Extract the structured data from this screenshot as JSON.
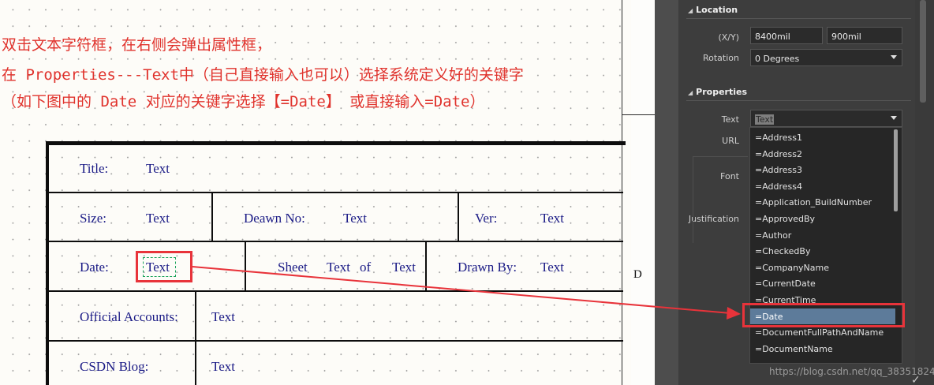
{
  "annotation": {
    "line1": "双击文本字符框，在右侧会弹出属性框，",
    "line2": "在 Properties---Text中（自己直接输入也可以）选择系统定义好的关键字",
    "line3": "（如下图中的 Date 对应的关键字选择【=Date】 或直接输入=Date）"
  },
  "title_block": {
    "title_label": "Title:",
    "title_value": "Text",
    "size_label": "Size:",
    "size_value": "Text",
    "drawn_no_label": "Deawn No:",
    "drawn_no_value": "Text",
    "ver_label": "Ver:",
    "ver_value": "Text",
    "date_label": "Date:",
    "date_value": "Text",
    "sheet_label": "Sheet",
    "sheet_value": "Text",
    "of_label": "of",
    "of_value": "Text",
    "drawn_by_label": "Drawn By:",
    "drawn_by_value": "Text",
    "official_label": "Official Accounts:",
    "official_value": "Text",
    "blog_label": "CSDN Blog:",
    "blog_value": "Text"
  },
  "sheet_border_letter": "D",
  "panel": {
    "location": {
      "header": "Location",
      "xy_label": "(X/Y)",
      "x_value": "8400mil",
      "y_value": "900mil",
      "rotation_label": "Rotation",
      "rotation_value": "0 Degrees"
    },
    "properties": {
      "header": "Properties",
      "text_label": "Text",
      "text_value": "Text",
      "url_label": "URL",
      "font_label": "Font",
      "justification_label": "Justification"
    },
    "dropdown_options": [
      "=Address1",
      "=Address2",
      "=Address3",
      "=Address4",
      "=Application_BuildNumber",
      "=ApprovedBy",
      "=Author",
      "=CheckedBy",
      "=CompanyName",
      "=CurrentDate",
      "=CurrentTime",
      "=Date",
      "=DocumentFullPathAndName",
      "=DocumentName"
    ],
    "selected_option": "=Date"
  },
  "watermark": "https://blog.csdn.net/qq_38351824",
  "colors": {
    "annotation_red": "#e0332d",
    "highlight_red": "#e8333a",
    "label_blue": "#1b1b86",
    "panel_bg": "#3d3d3d",
    "dropdown_selected": "#5d7b9a"
  }
}
